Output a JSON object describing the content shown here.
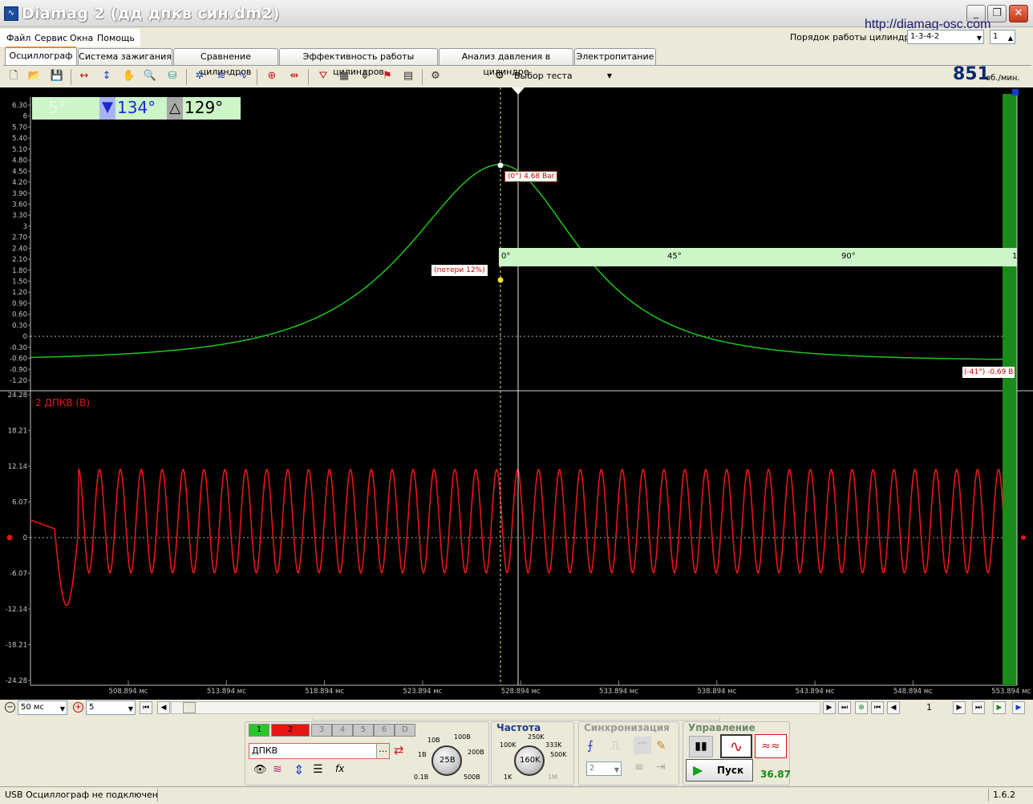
{
  "window": {
    "title": "Diamag 2 (дд дпкв син.dm2)",
    "url": "http://diamag-osc.com",
    "min": "_",
    "max": "❐",
    "close": "✕"
  },
  "menu": [
    "Файл",
    "Сервис",
    "Окна",
    "Помощь"
  ],
  "firing_order": {
    "label": "Порядок работы цилиндров",
    "value": "1-3-4-2",
    "cylinder": "1"
  },
  "tabs": [
    "Осциллограф",
    "Система зажигания",
    "Сравнение цилиндров",
    "Эффективность работы цилиндров",
    "Анализ давления в цилиндре",
    "Электропитание"
  ],
  "active_tab": "Осциллограф",
  "toolbar": {
    "test_select": "Выбор теста",
    "rpm": "851",
    "rpm_unit": "об./мин."
  },
  "cursor": {
    "left": "5°",
    "mid": "134°",
    "delta": "129°"
  },
  "channel1": {
    "yticks": [
      "6.30",
      "6",
      "5.70",
      "5.40",
      "5.10",
      "4.80",
      "4.50",
      "4.20",
      "3.90",
      "3.60",
      "3.30",
      "3",
      "2.70",
      "2.40",
      "2.10",
      "1.80",
      "1.50",
      "1.20",
      "0.90",
      "0.60",
      "0.30",
      "0",
      "-0.30",
      "-0.60",
      "-0.90",
      "-1.20"
    ],
    "peak_label": "(0°) 4.68 Bar",
    "loss_label": "(потери 12%)",
    "end_label": "(-41°) -0.69 B",
    "angle_ticks": [
      "0°",
      "45°",
      "90°",
      "1"
    ]
  },
  "channel2": {
    "name": "2 ДПКВ (В)",
    "yticks": [
      "24.28",
      "18.21",
      "12.14",
      "6.07",
      "0",
      "-6.07",
      "-12.14",
      "-18.21",
      "-24.28"
    ]
  },
  "time_axis": [
    "508.894 мс",
    "513.894 мс",
    "518.894 мс",
    "523.894 мс",
    "528.894 мс",
    "533.894 мс",
    "538.894 мс",
    "543.894 мс",
    "548.894 мс",
    "553.894 мс"
  ],
  "scroll": {
    "timebase": "50 мс",
    "zoom": "5",
    "page": "1"
  },
  "controls": {
    "channels": [
      "1",
      "2",
      "3",
      "4",
      "5",
      "6",
      "D"
    ],
    "sensor": "ДПКВ",
    "voltage_labels": [
      "10В",
      "100В",
      "200В",
      "500В",
      "0.1В",
      "1В"
    ],
    "voltage_value": "25В",
    "freq_title": "Частота",
    "freq_labels": [
      "250K",
      "333K",
      "500K",
      "100K",
      "1K",
      "1M"
    ],
    "freq_value": "160K",
    "sync_title": "Синхронизация",
    "sync_value": "2",
    "ctrl_title": "Управление",
    "start": "Пуск",
    "value": "36.87"
  },
  "status": {
    "text": "USB Осциллограф не подключен",
    "version": "1.6.2"
  },
  "chart_data": [
    {
      "type": "line",
      "title": "",
      "ylabel": "",
      "ylim": [
        -1.2,
        6.3
      ],
      "series": [
        {
          "name": "",
          "points": "pressure curve peak 4.68 at 0°, ends -0.69"
        }
      ]
    },
    {
      "type": "line",
      "title": "2 ДПКВ (В)",
      "ylim": [
        -24.28,
        24.28
      ],
      "series": [
        {
          "name": "2 ДПКВ (В)",
          "amplitude": "≈ -6 to 12 V sine, 45 cycles"
        }
      ]
    }
  ]
}
